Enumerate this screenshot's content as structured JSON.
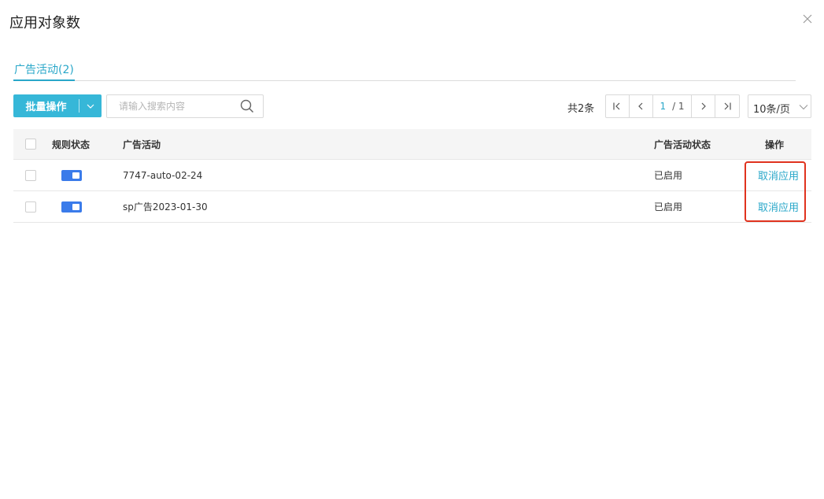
{
  "dialog": {
    "title": "应用对象数"
  },
  "tabs": [
    {
      "label": "广告活动",
      "count": "(2)"
    }
  ],
  "toolbar": {
    "batch_label": "批量操作",
    "search_placeholder": "请输入搜索内容",
    "total_text": "共2条",
    "page_current": "1",
    "page_of": "/ 1",
    "per_page": "10条/页"
  },
  "table": {
    "headers": {
      "rule_status": "规则状态",
      "campaign": "广告活动",
      "campaign_status": "广告活动状态",
      "actions": "操作"
    },
    "rows": [
      {
        "rule_enabled": true,
        "campaign": "7747-auto-02-24",
        "campaign_status": "已启用",
        "action": "取消应用"
      },
      {
        "rule_enabled": true,
        "campaign": "sp广告2023-01-30",
        "campaign_status": "已启用",
        "action": "取消应用"
      }
    ]
  },
  "colors": {
    "accent": "#29a7c9",
    "button": "#36b7d8",
    "toggle_on": "#3a7bea",
    "highlight": "#e0321e"
  },
  "icons": [
    "close-icon",
    "chevron-down-icon",
    "search-icon",
    "first-page-icon",
    "prev-page-icon",
    "next-page-icon",
    "last-page-icon"
  ]
}
